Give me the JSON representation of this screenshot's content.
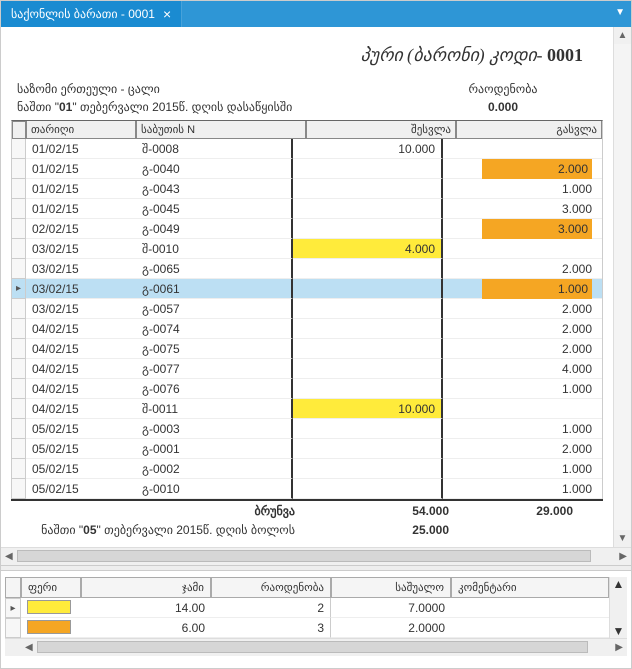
{
  "tab": {
    "title": "საქონლის ბარათი - 0001"
  },
  "header": {
    "product_name": "პური (ბარონი)",
    "code_label": "კოდი-",
    "code": "0001",
    "unit_line": "საზომი ერთეული - ცალი",
    "opening_line_pre": "ნაშთი \"",
    "opening_day": "01",
    "opening_line_mid": "\" თებერვალი 2015წ. დღის დასაწყისში",
    "qty_label": "რაოდენობა",
    "qty_value": "0.000"
  },
  "columns": {
    "date": "თარიღი",
    "doc": "საბუთის N",
    "in": "შესვლა",
    "out": "გასვლა"
  },
  "rows": [
    {
      "date": "01/02/15",
      "doc": "შ-0008",
      "in": "10.000",
      "out": "",
      "in_hl": null,
      "out_hl": null
    },
    {
      "date": "01/02/15",
      "doc": "გ-0040",
      "in": "",
      "out": "2.000",
      "in_hl": null,
      "out_hl": "orange"
    },
    {
      "date": "01/02/15",
      "doc": "გ-0043",
      "in": "",
      "out": "1.000",
      "in_hl": null,
      "out_hl": null
    },
    {
      "date": "01/02/15",
      "doc": "გ-0045",
      "in": "",
      "out": "3.000",
      "in_hl": null,
      "out_hl": null
    },
    {
      "date": "02/02/15",
      "doc": "გ-0049",
      "in": "",
      "out": "3.000",
      "in_hl": null,
      "out_hl": "orange"
    },
    {
      "date": "03/02/15",
      "doc": "შ-0010",
      "in": "4.000",
      "out": "",
      "in_hl": "yellow",
      "out_hl": null
    },
    {
      "date": "03/02/15",
      "doc": "გ-0065",
      "in": "",
      "out": "2.000",
      "in_hl": null,
      "out_hl": null
    },
    {
      "date": "03/02/15",
      "doc": "გ-0061",
      "in": "",
      "out": "1.000",
      "in_hl": null,
      "out_hl": "orange",
      "selected": true
    },
    {
      "date": "03/02/15",
      "doc": "გ-0057",
      "in": "",
      "out": "2.000",
      "in_hl": null,
      "out_hl": null
    },
    {
      "date": "04/02/15",
      "doc": "გ-0074",
      "in": "",
      "out": "2.000",
      "in_hl": null,
      "out_hl": null
    },
    {
      "date": "04/02/15",
      "doc": "გ-0075",
      "in": "",
      "out": "2.000",
      "in_hl": null,
      "out_hl": null
    },
    {
      "date": "04/02/15",
      "doc": "გ-0077",
      "in": "",
      "out": "4.000",
      "in_hl": null,
      "out_hl": null
    },
    {
      "date": "04/02/15",
      "doc": "გ-0076",
      "in": "",
      "out": "1.000",
      "in_hl": null,
      "out_hl": null
    },
    {
      "date": "04/02/15",
      "doc": "შ-0011",
      "in": "10.000",
      "out": "",
      "in_hl": "yellow",
      "out_hl": null
    },
    {
      "date": "05/02/15",
      "doc": "გ-0003",
      "in": "",
      "out": "1.000",
      "in_hl": null,
      "out_hl": null
    },
    {
      "date": "05/02/15",
      "doc": "გ-0001",
      "in": "",
      "out": "2.000",
      "in_hl": null,
      "out_hl": null
    },
    {
      "date": "05/02/15",
      "doc": "გ-0002",
      "in": "",
      "out": "1.000",
      "in_hl": null,
      "out_hl": null
    },
    {
      "date": "05/02/15",
      "doc": "გ-0010",
      "in": "",
      "out": "1.000",
      "in_hl": null,
      "out_hl": null
    }
  ],
  "totals": {
    "label": "ბრუნვა",
    "in": "54.000",
    "out": "29.000"
  },
  "closing": {
    "pre": "ნაშთი \"",
    "day": "05",
    "post": "\" თებერვალი 2015წ. დღის ბოლოს",
    "value": "25.000"
  },
  "lower": {
    "columns": {
      "color": "ფერი",
      "sum": "ჯამი",
      "qty": "რაოდენობა",
      "avg": "საშუალო",
      "comment": "კომენტარი"
    },
    "rows": [
      {
        "color": "#ffeb3b",
        "sum": "14.00",
        "qty": "2",
        "avg": "7.0000",
        "comment": "",
        "selected": true
      },
      {
        "color": "#f5a623",
        "sum": "6.00",
        "qty": "3",
        "avg": "2.0000",
        "comment": ""
      }
    ]
  }
}
